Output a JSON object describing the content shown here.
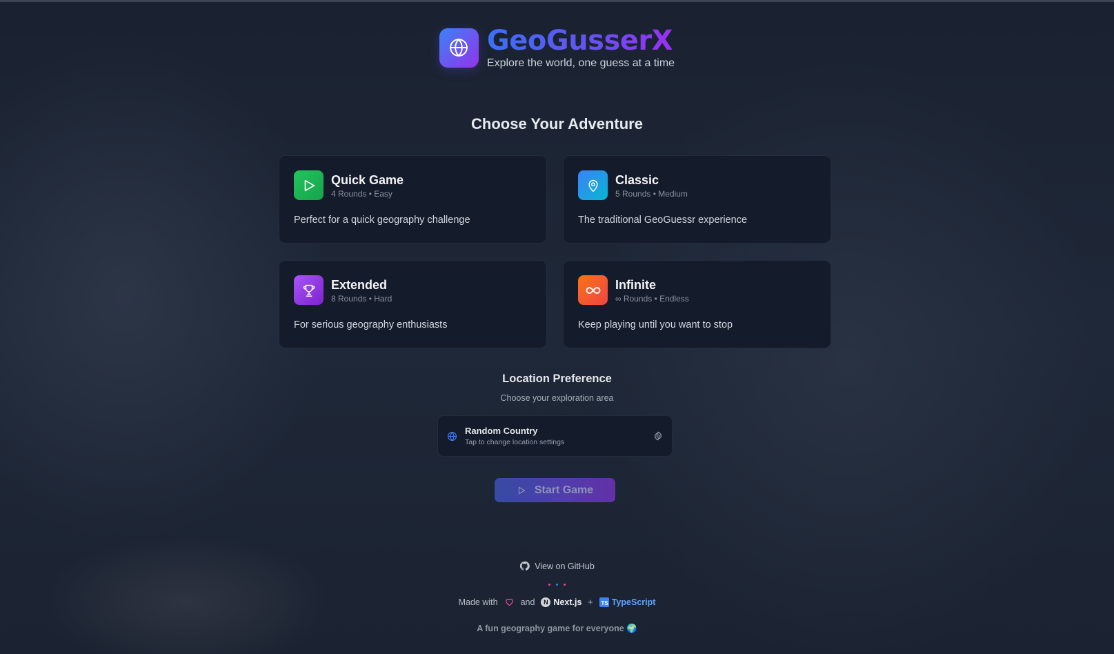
{
  "header": {
    "title": "GeoGusserX",
    "subtitle": "Explore the world, one guess at a time",
    "logo_icon": "globe-icon"
  },
  "main": {
    "heading": "Choose Your Adventure",
    "modes": [
      {
        "title": "Quick Game",
        "meta": "4 Rounds • Easy",
        "description": "Perfect for a quick geography challenge",
        "icon": "play-icon",
        "color": "#22c55e"
      },
      {
        "title": "Classic",
        "meta": "5 Rounds • Medium",
        "description": "The traditional GeoGuessr experience",
        "icon": "map-pin-icon",
        "color": "#3b82f6"
      },
      {
        "title": "Extended",
        "meta": "8 Rounds • Hard",
        "description": "For serious geography enthusiasts",
        "icon": "trophy-icon",
        "color": "#a855f7"
      },
      {
        "title": "Infinite",
        "meta": "∞ Rounds • Endless",
        "description": "Keep playing until you want to stop",
        "icon": "infinity-icon",
        "color": "#f97316"
      }
    ]
  },
  "location": {
    "heading": "Location Preference",
    "subheading": "Choose your exploration area",
    "selected": "Random Country",
    "hint": "Tap to change location settings"
  },
  "start_button": {
    "label": "Start Game"
  },
  "footer": {
    "github_label": "View on GitHub",
    "made_with": "Made with",
    "and": "and",
    "nextjs": "Next.js",
    "plus": "+",
    "typescript": "TypeScript",
    "ts_badge": "TS",
    "n_badge": "N",
    "tagline": "A fun geography game for everyone 🌍",
    "dot_colors": [
      "#ec4899",
      "#3b82f6",
      "#ec4899"
    ]
  }
}
